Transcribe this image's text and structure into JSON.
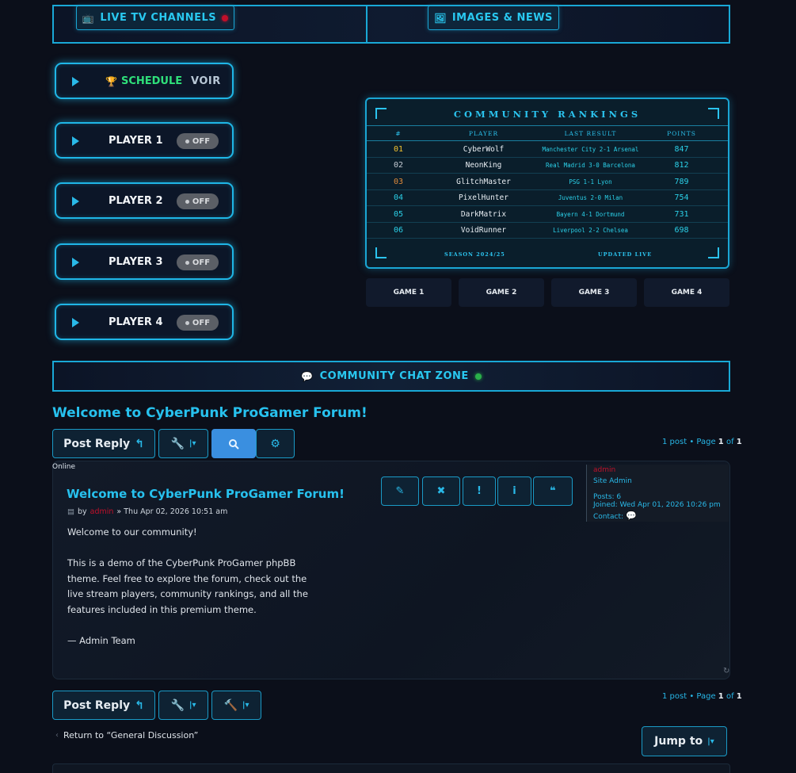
{
  "top_tabs": {
    "tv": {
      "icon": "📺",
      "label": "LIVE TV CHANNELS"
    },
    "images": {
      "icon": "🖼",
      "label": "IMAGES & NEWS"
    }
  },
  "sidebar": {
    "schedule": {
      "icon": "🏆",
      "label": "SCHEDULE",
      "voir": "VOIR"
    },
    "players": [
      {
        "label": "PLAYER 1",
        "toggle": "OFF"
      },
      {
        "label": "PLAYER 2",
        "toggle": "OFF"
      },
      {
        "label": "PLAYER 3",
        "toggle": "OFF"
      },
      {
        "label": "PLAYER 4",
        "toggle": "OFF"
      }
    ]
  },
  "rankings": {
    "title": "COMMUNITY RANKINGS",
    "headers": {
      "rank": "#",
      "player": "PLAYER",
      "result": "LAST RESULT",
      "points": "POINTS"
    },
    "rows": [
      {
        "rank": "01",
        "player": "CyberWolf",
        "result": "Manchester City 2-1 Arsenal",
        "points": "847",
        "rank_color": "#f2c230"
      },
      {
        "rank": "02",
        "player": "NeonKing",
        "result": "Real Madrid 3-0 Barcelona",
        "points": "812",
        "rank_color": "#c4cbd3"
      },
      {
        "rank": "03",
        "player": "GlitchMaster",
        "result": "PSG 1-1 Lyon",
        "points": "789",
        "rank_color": "#e08a3a"
      },
      {
        "rank": "04",
        "player": "PixelHunter",
        "result": "Juventus 2-0 Milan",
        "points": "754",
        "rank_color": "#2bd0e8"
      },
      {
        "rank": "05",
        "player": "DarkMatrix",
        "result": "Bayern 4-1 Dortmund",
        "points": "731",
        "rank_color": "#2bd0e8"
      },
      {
        "rank": "06",
        "player": "VoidRunner",
        "result": "Liverpool 2-2 Chelsea",
        "points": "698",
        "rank_color": "#2bd0e8"
      }
    ],
    "footer_left": "SEASON 2024/25",
    "footer_right": "UPDATED LIVE"
  },
  "games": [
    "GAME 1",
    "GAME 2",
    "GAME 3",
    "GAME 4"
  ],
  "chat": {
    "icon": "💬",
    "label": "COMMUNITY CHAT ZONE"
  },
  "topic": {
    "title": "Welcome to CyberPunk ProGamer Forum!",
    "post_reply": "Post Reply",
    "pagination": {
      "prefix": "1 post • Page",
      "current": "1",
      "of": "of",
      "total": "1"
    }
  },
  "post": {
    "status": "Online",
    "title": "Welcome to CyberPunk ProGamer Forum!",
    "by": "by",
    "author": "admin",
    "date": "» Thu Apr 02, 2026 10:51 am",
    "body": [
      "Welcome to our community!",
      "This is a demo of the CyberPunk ProGamer phpBB theme. Feel free to explore the forum, check out the live stream players, community rankings, and all the features included in this premium theme.",
      "— Admin Team"
    ]
  },
  "profile": {
    "name": "admin",
    "rank": "Site Admin",
    "posts": "Posts: 6",
    "joined": "Joined: Wed Apr 01, 2026 10:26 pm",
    "contact": "Contact:"
  },
  "footer": {
    "return_link": "Return to “General Discussion”",
    "jump_to": "Jump to"
  }
}
